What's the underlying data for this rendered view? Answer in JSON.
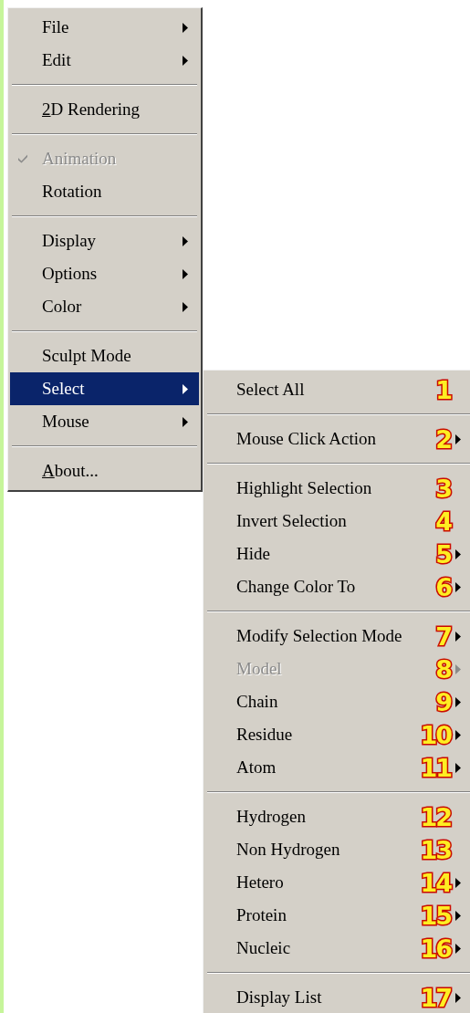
{
  "menu": {
    "items": [
      {
        "kind": "item",
        "label": "File",
        "submenu": true,
        "selected": false,
        "disabled": false,
        "checked": false
      },
      {
        "kind": "item",
        "label": "Edit",
        "submenu": true,
        "selected": false,
        "disabled": false,
        "checked": false
      },
      {
        "kind": "separator"
      },
      {
        "kind": "item",
        "label": "2D Rendering",
        "underline_first": true,
        "submenu": false,
        "selected": false,
        "disabled": false,
        "checked": false
      },
      {
        "kind": "separator"
      },
      {
        "kind": "item",
        "label": "Animation",
        "submenu": false,
        "selected": false,
        "disabled": true,
        "checked": true
      },
      {
        "kind": "item",
        "label": "Rotation",
        "submenu": false,
        "selected": false,
        "disabled": false,
        "checked": false
      },
      {
        "kind": "separator"
      },
      {
        "kind": "item",
        "label": "Display",
        "submenu": true,
        "selected": false,
        "disabled": false,
        "checked": false
      },
      {
        "kind": "item",
        "label": "Options",
        "submenu": true,
        "selected": false,
        "disabled": false,
        "checked": false
      },
      {
        "kind": "item",
        "label": "Color",
        "submenu": true,
        "selected": false,
        "disabled": false,
        "checked": false
      },
      {
        "kind": "separator"
      },
      {
        "kind": "item",
        "label": "Sculpt Mode",
        "submenu": false,
        "selected": false,
        "disabled": false,
        "checked": false
      },
      {
        "kind": "item",
        "label": "Select",
        "submenu": true,
        "selected": true,
        "disabled": false,
        "checked": false
      },
      {
        "kind": "item",
        "label": "Mouse",
        "submenu": true,
        "selected": false,
        "disabled": false,
        "checked": false
      },
      {
        "kind": "separator"
      },
      {
        "kind": "item",
        "label": "About...",
        "underline_first": true,
        "submenu": false,
        "selected": false,
        "disabled": false,
        "checked": false
      }
    ]
  },
  "submenu": {
    "items": [
      {
        "kind": "item",
        "label": "Select All",
        "badge": "1",
        "submenu": false,
        "selected": false,
        "disabled": false
      },
      {
        "kind": "separator"
      },
      {
        "kind": "item",
        "label": "Mouse Click Action",
        "badge": "2",
        "submenu": true,
        "selected": false,
        "disabled": false
      },
      {
        "kind": "separator"
      },
      {
        "kind": "item",
        "label": "Highlight Selection",
        "badge": "3",
        "submenu": false,
        "selected": false,
        "disabled": false
      },
      {
        "kind": "item",
        "label": "Invert Selection",
        "badge": "4",
        "submenu": false,
        "selected": false,
        "disabled": false
      },
      {
        "kind": "item",
        "label": "Hide",
        "badge": "5",
        "submenu": true,
        "selected": false,
        "disabled": false
      },
      {
        "kind": "item",
        "label": "Change Color To",
        "badge": "6",
        "submenu": true,
        "selected": false,
        "disabled": false
      },
      {
        "kind": "separator"
      },
      {
        "kind": "item",
        "label": "Modify Selection Mode",
        "badge": "7",
        "submenu": true,
        "selected": false,
        "disabled": false
      },
      {
        "kind": "item",
        "label": "Model",
        "badge": "8",
        "submenu": true,
        "selected": false,
        "disabled": true
      },
      {
        "kind": "item",
        "label": "Chain",
        "badge": "9",
        "submenu": true,
        "selected": false,
        "disabled": false
      },
      {
        "kind": "item",
        "label": "Residue",
        "badge": "10",
        "submenu": true,
        "selected": false,
        "disabled": false
      },
      {
        "kind": "item",
        "label": "Atom",
        "badge": "11",
        "submenu": true,
        "selected": false,
        "disabled": false
      },
      {
        "kind": "separator"
      },
      {
        "kind": "item",
        "label": "Hydrogen",
        "badge": "12",
        "submenu": false,
        "selected": false,
        "disabled": false
      },
      {
        "kind": "item",
        "label": "Non Hydrogen",
        "badge": "13",
        "submenu": false,
        "selected": false,
        "disabled": false
      },
      {
        "kind": "item",
        "label": "Hetero",
        "badge": "14",
        "submenu": true,
        "selected": false,
        "disabled": false
      },
      {
        "kind": "item",
        "label": "Protein",
        "badge": "15",
        "submenu": true,
        "selected": false,
        "disabled": false
      },
      {
        "kind": "item",
        "label": "Nucleic",
        "badge": "16",
        "submenu": true,
        "selected": false,
        "disabled": false
      },
      {
        "kind": "separator"
      },
      {
        "kind": "item",
        "label": "Display List",
        "badge": "17",
        "submenu": true,
        "selected": false,
        "disabled": false
      }
    ]
  }
}
